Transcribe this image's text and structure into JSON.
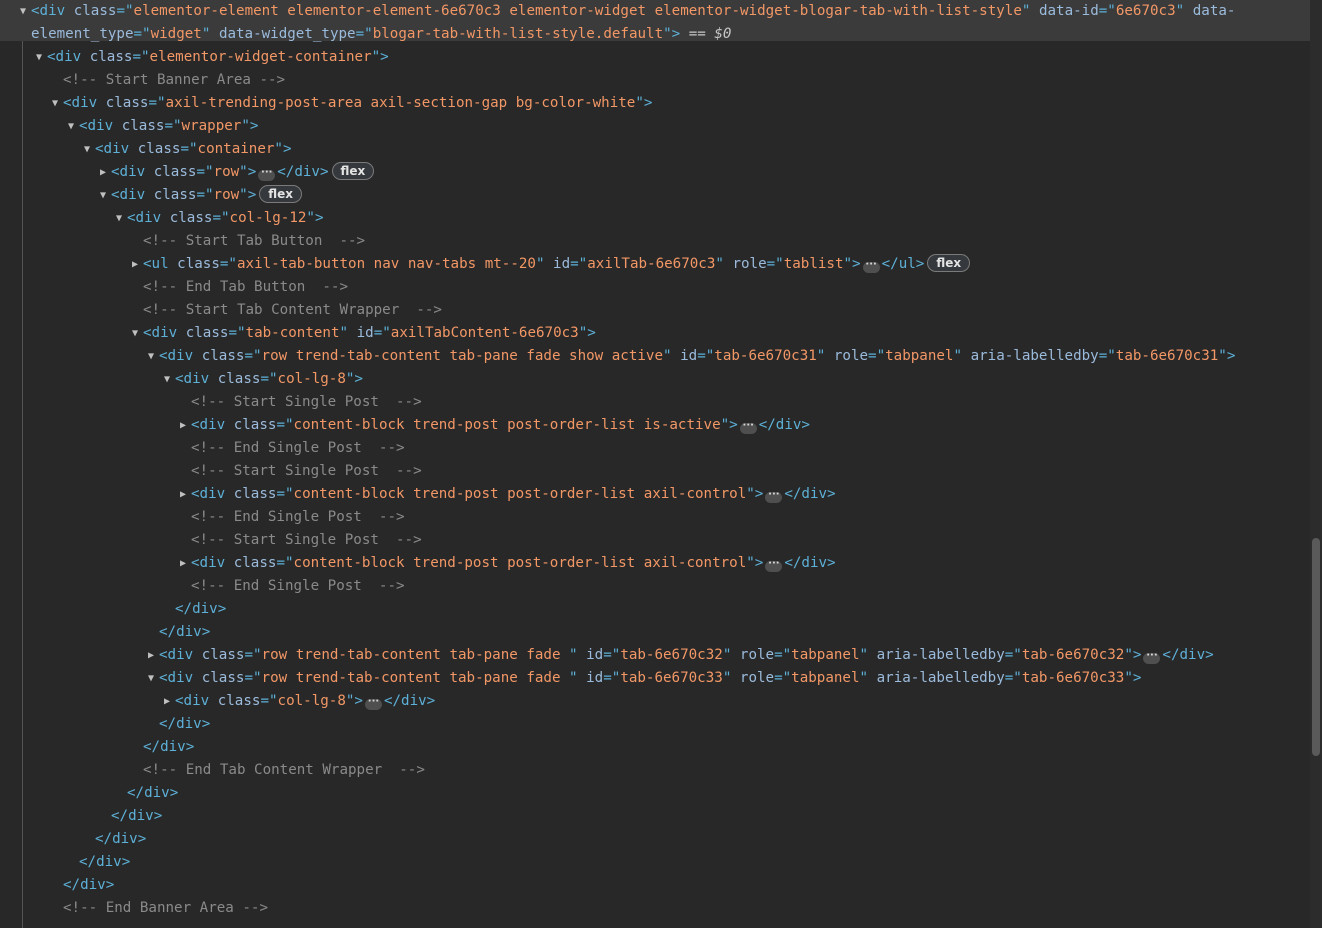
{
  "nodes": [
    {
      "toggle": "open",
      "selected": true,
      "segments": [
        {
          "t": "<div ",
          "c": "tag"
        },
        {
          "t": "class",
          "c": "attr"
        },
        {
          "t": "=\"",
          "c": "tag"
        },
        {
          "t": "elementor-element elementor-element-6e670c3 elementor-widget elementor-widget-blogar-tab-with-list-style",
          "c": "val"
        },
        {
          "t": "\" ",
          "c": "tag"
        },
        {
          "t": "data-id",
          "c": "attr"
        },
        {
          "t": "=\"",
          "c": "tag"
        },
        {
          "t": "6e670c3",
          "c": "val"
        },
        {
          "t": "\" ",
          "c": "tag"
        },
        {
          "t": "data-",
          "c": "attr"
        }
      ]
    },
    {
      "toggle": "none",
      "segments": [
        {
          "t": "element_type",
          "c": "attr"
        },
        {
          "t": "=\"",
          "c": "tag"
        },
        {
          "t": "widget",
          "c": "val"
        },
        {
          "t": "\" ",
          "c": "tag"
        },
        {
          "t": "data-widget_type",
          "c": "attr"
        },
        {
          "t": "=\"",
          "c": "tag"
        },
        {
          "t": "blogar-tab-with-list-style.default",
          "c": "val"
        },
        {
          "t": "\">",
          "c": "tag"
        },
        {
          "t": " == ",
          "c": "eq"
        },
        {
          "t": "$0",
          "c": "dollar"
        }
      ]
    },
    {
      "toggle": "open",
      "segments": [
        {
          "t": "<div ",
          "c": "tag"
        },
        {
          "t": "class",
          "c": "attr"
        },
        {
          "t": "=\"",
          "c": "tag"
        },
        {
          "t": "elementor-widget-container",
          "c": "val"
        },
        {
          "t": "\">",
          "c": "tag"
        }
      ]
    },
    {
      "toggle": "none",
      "segments": [
        {
          "t": "<!-- Start Banner Area -->",
          "c": "cmt"
        }
      ]
    },
    {
      "toggle": "open",
      "segments": [
        {
          "t": "<div ",
          "c": "tag"
        },
        {
          "t": "class",
          "c": "attr"
        },
        {
          "t": "=\"",
          "c": "tag"
        },
        {
          "t": "axil-trending-post-area axil-section-gap bg-color-white",
          "c": "val"
        },
        {
          "t": "\">",
          "c": "tag"
        }
      ]
    },
    {
      "toggle": "open",
      "segments": [
        {
          "t": "<div ",
          "c": "tag"
        },
        {
          "t": "class",
          "c": "attr"
        },
        {
          "t": "=\"",
          "c": "tag"
        },
        {
          "t": "wrapper",
          "c": "val"
        },
        {
          "t": "\">",
          "c": "tag"
        }
      ]
    },
    {
      "toggle": "open",
      "segments": [
        {
          "t": "<div ",
          "c": "tag"
        },
        {
          "t": "class",
          "c": "attr"
        },
        {
          "t": "=\"",
          "c": "tag"
        },
        {
          "t": "container",
          "c": "val"
        },
        {
          "t": "\">",
          "c": "tag"
        }
      ]
    },
    {
      "toggle": "closed",
      "segments": [
        {
          "t": "<div ",
          "c": "tag"
        },
        {
          "t": "class",
          "c": "attr"
        },
        {
          "t": "=\"",
          "c": "tag"
        },
        {
          "t": "row",
          "c": "val"
        },
        {
          "t": "\">",
          "c": "tag"
        },
        {
          "t": "···",
          "c": "ellip"
        },
        {
          "t": "</div>",
          "c": "tag"
        },
        {
          "t": "flex",
          "c": "badge"
        }
      ]
    },
    {
      "toggle": "open",
      "segments": [
        {
          "t": "<div ",
          "c": "tag"
        },
        {
          "t": "class",
          "c": "attr"
        },
        {
          "t": "=\"",
          "c": "tag"
        },
        {
          "t": "row",
          "c": "val"
        },
        {
          "t": "\">",
          "c": "tag"
        },
        {
          "t": "flex",
          "c": "badge"
        }
      ]
    },
    {
      "toggle": "open",
      "segments": [
        {
          "t": "<div ",
          "c": "tag"
        },
        {
          "t": "class",
          "c": "attr"
        },
        {
          "t": "=\"",
          "c": "tag"
        },
        {
          "t": "col-lg-12",
          "c": "val"
        },
        {
          "t": "\">",
          "c": "tag"
        }
      ]
    },
    {
      "toggle": "none",
      "segments": [
        {
          "t": "<!-- Start Tab Button  -->",
          "c": "cmt"
        }
      ]
    },
    {
      "toggle": "closed",
      "segments": [
        {
          "t": "<ul ",
          "c": "tag"
        },
        {
          "t": "class",
          "c": "attr"
        },
        {
          "t": "=\"",
          "c": "tag"
        },
        {
          "t": "axil-tab-button nav nav-tabs mt--20",
          "c": "val"
        },
        {
          "t": "\" ",
          "c": "tag"
        },
        {
          "t": "id",
          "c": "attr"
        },
        {
          "t": "=\"",
          "c": "tag"
        },
        {
          "t": "axilTab-6e670c3",
          "c": "val"
        },
        {
          "t": "\" ",
          "c": "tag"
        },
        {
          "t": "role",
          "c": "attr"
        },
        {
          "t": "=\"",
          "c": "tag"
        },
        {
          "t": "tablist",
          "c": "val"
        },
        {
          "t": "\">",
          "c": "tag"
        },
        {
          "t": "···",
          "c": "ellip"
        },
        {
          "t": "</ul>",
          "c": "tag"
        },
        {
          "t": "flex",
          "c": "badge"
        }
      ]
    },
    {
      "toggle": "none",
      "segments": [
        {
          "t": "<!-- End Tab Button  -->",
          "c": "cmt"
        }
      ]
    },
    {
      "toggle": "none",
      "segments": [
        {
          "t": "<!-- Start Tab Content Wrapper  -->",
          "c": "cmt"
        }
      ]
    },
    {
      "toggle": "open",
      "segments": [
        {
          "t": "<div ",
          "c": "tag"
        },
        {
          "t": "class",
          "c": "attr"
        },
        {
          "t": "=\"",
          "c": "tag"
        },
        {
          "t": "tab-content",
          "c": "val"
        },
        {
          "t": "\" ",
          "c": "tag"
        },
        {
          "t": "id",
          "c": "attr"
        },
        {
          "t": "=\"",
          "c": "tag"
        },
        {
          "t": "axilTabContent-6e670c3",
          "c": "val"
        },
        {
          "t": "\">",
          "c": "tag"
        }
      ]
    },
    {
      "toggle": "open",
      "segments": [
        {
          "t": "<div ",
          "c": "tag"
        },
        {
          "t": "class",
          "c": "attr"
        },
        {
          "t": "=\"",
          "c": "tag"
        },
        {
          "t": "row trend-tab-content tab-pane fade show active",
          "c": "val"
        },
        {
          "t": "\" ",
          "c": "tag"
        },
        {
          "t": "id",
          "c": "attr"
        },
        {
          "t": "=\"",
          "c": "tag"
        },
        {
          "t": "tab-6e670c31",
          "c": "val"
        },
        {
          "t": "\" ",
          "c": "tag"
        },
        {
          "t": "role",
          "c": "attr"
        },
        {
          "t": "=\"",
          "c": "tag"
        },
        {
          "t": "tabpanel",
          "c": "val"
        },
        {
          "t": "\" ",
          "c": "tag"
        },
        {
          "t": "aria-labelledby",
          "c": "attr"
        },
        {
          "t": "=\"",
          "c": "tag"
        },
        {
          "t": "tab-6e670c31",
          "c": "val"
        },
        {
          "t": "\">",
          "c": "tag"
        }
      ]
    },
    {
      "toggle": "open",
      "segments": [
        {
          "t": "<div ",
          "c": "tag"
        },
        {
          "t": "class",
          "c": "attr"
        },
        {
          "t": "=\"",
          "c": "tag"
        },
        {
          "t": "col-lg-8",
          "c": "val"
        },
        {
          "t": "\">",
          "c": "tag"
        }
      ]
    },
    {
      "toggle": "none",
      "segments": [
        {
          "t": "<!-- Start Single Post  -->",
          "c": "cmt"
        }
      ]
    },
    {
      "toggle": "closed",
      "segments": [
        {
          "t": "<div ",
          "c": "tag"
        },
        {
          "t": "class",
          "c": "attr"
        },
        {
          "t": "=\"",
          "c": "tag"
        },
        {
          "t": "content-block trend-post post-order-list is-active",
          "c": "val"
        },
        {
          "t": "\">",
          "c": "tag"
        },
        {
          "t": "···",
          "c": "ellip"
        },
        {
          "t": "</div>",
          "c": "tag"
        }
      ]
    },
    {
      "toggle": "none",
      "segments": [
        {
          "t": "<!-- End Single Post  -->",
          "c": "cmt"
        }
      ]
    },
    {
      "toggle": "none",
      "segments": [
        {
          "t": "<!-- Start Single Post  -->",
          "c": "cmt"
        }
      ]
    },
    {
      "toggle": "closed",
      "segments": [
        {
          "t": "<div ",
          "c": "tag"
        },
        {
          "t": "class",
          "c": "attr"
        },
        {
          "t": "=\"",
          "c": "tag"
        },
        {
          "t": "content-block trend-post post-order-list axil-control",
          "c": "val"
        },
        {
          "t": "\">",
          "c": "tag"
        },
        {
          "t": "···",
          "c": "ellip"
        },
        {
          "t": "</div>",
          "c": "tag"
        }
      ]
    },
    {
      "toggle": "none",
      "segments": [
        {
          "t": "<!-- End Single Post  -->",
          "c": "cmt"
        }
      ]
    },
    {
      "toggle": "none",
      "segments": [
        {
          "t": "<!-- Start Single Post  -->",
          "c": "cmt"
        }
      ]
    },
    {
      "toggle": "closed",
      "segments": [
        {
          "t": "<div ",
          "c": "tag"
        },
        {
          "t": "class",
          "c": "attr"
        },
        {
          "t": "=\"",
          "c": "tag"
        },
        {
          "t": "content-block trend-post post-order-list axil-control",
          "c": "val"
        },
        {
          "t": "\">",
          "c": "tag"
        },
        {
          "t": "···",
          "c": "ellip"
        },
        {
          "t": "</div>",
          "c": "tag"
        }
      ]
    },
    {
      "toggle": "none",
      "segments": [
        {
          "t": "<!-- End Single Post  -->",
          "c": "cmt"
        }
      ]
    },
    {
      "toggle": "none",
      "segments": [
        {
          "t": "</div>",
          "c": "tag"
        }
      ]
    },
    {
      "toggle": "none",
      "segments": [
        {
          "t": "</div>",
          "c": "tag"
        }
      ]
    },
    {
      "toggle": "closed",
      "segments": [
        {
          "t": "<div ",
          "c": "tag"
        },
        {
          "t": "class",
          "c": "attr"
        },
        {
          "t": "=\"",
          "c": "tag"
        },
        {
          "t": "row trend-tab-content tab-pane fade ",
          "c": "val"
        },
        {
          "t": "\" ",
          "c": "tag"
        },
        {
          "t": "id",
          "c": "attr"
        },
        {
          "t": "=\"",
          "c": "tag"
        },
        {
          "t": "tab-6e670c32",
          "c": "val"
        },
        {
          "t": "\" ",
          "c": "tag"
        },
        {
          "t": "role",
          "c": "attr"
        },
        {
          "t": "=\"",
          "c": "tag"
        },
        {
          "t": "tabpanel",
          "c": "val"
        },
        {
          "t": "\" ",
          "c": "tag"
        },
        {
          "t": "aria-labelledby",
          "c": "attr"
        },
        {
          "t": "=\"",
          "c": "tag"
        },
        {
          "t": "tab-6e670c32",
          "c": "val"
        },
        {
          "t": "\">",
          "c": "tag"
        },
        {
          "t": "···",
          "c": "ellip"
        },
        {
          "t": "</div>",
          "c": "tag"
        }
      ]
    },
    {
      "toggle": "open",
      "segments": [
        {
          "t": "<div ",
          "c": "tag"
        },
        {
          "t": "class",
          "c": "attr"
        },
        {
          "t": "=\"",
          "c": "tag"
        },
        {
          "t": "row trend-tab-content tab-pane fade ",
          "c": "val"
        },
        {
          "t": "\" ",
          "c": "tag"
        },
        {
          "t": "id",
          "c": "attr"
        },
        {
          "t": "=\"",
          "c": "tag"
        },
        {
          "t": "tab-6e670c33",
          "c": "val"
        },
        {
          "t": "\" ",
          "c": "tag"
        },
        {
          "t": "role",
          "c": "attr"
        },
        {
          "t": "=\"",
          "c": "tag"
        },
        {
          "t": "tabpanel",
          "c": "val"
        },
        {
          "t": "\" ",
          "c": "tag"
        },
        {
          "t": "aria-labelledby",
          "c": "attr"
        },
        {
          "t": "=\"",
          "c": "tag"
        },
        {
          "t": "tab-6e670c33",
          "c": "val"
        },
        {
          "t": "\">",
          "c": "tag"
        }
      ]
    },
    {
      "toggle": "closed",
      "segments": [
        {
          "t": "<div ",
          "c": "tag"
        },
        {
          "t": "class",
          "c": "attr"
        },
        {
          "t": "=\"",
          "c": "tag"
        },
        {
          "t": "col-lg-8",
          "c": "val"
        },
        {
          "t": "\">",
          "c": "tag"
        },
        {
          "t": "···",
          "c": "ellip"
        },
        {
          "t": "</div>",
          "c": "tag"
        }
      ]
    },
    {
      "toggle": "none",
      "segments": [
        {
          "t": "</div>",
          "c": "tag"
        }
      ]
    },
    {
      "toggle": "none",
      "segments": [
        {
          "t": "</div>",
          "c": "tag"
        }
      ]
    },
    {
      "toggle": "none",
      "segments": [
        {
          "t": "<!-- End Tab Content Wrapper  -->",
          "c": "cmt"
        }
      ]
    },
    {
      "toggle": "none",
      "segments": [
        {
          "t": "</div>",
          "c": "tag"
        }
      ]
    },
    {
      "toggle": "none",
      "segments": [
        {
          "t": "</div>",
          "c": "tag"
        }
      ]
    },
    {
      "toggle": "none",
      "segments": [
        {
          "t": "</div>",
          "c": "tag"
        }
      ]
    },
    {
      "toggle": "none",
      "segments": [
        {
          "t": "</div>",
          "c": "tag"
        }
      ]
    },
    {
      "toggle": "none",
      "segments": [
        {
          "t": "</div>",
          "c": "tag"
        }
      ]
    },
    {
      "toggle": "none",
      "segments": [
        {
          "t": "<!-- End Banner Area -->",
          "c": "cmt"
        }
      ]
    }
  ]
}
